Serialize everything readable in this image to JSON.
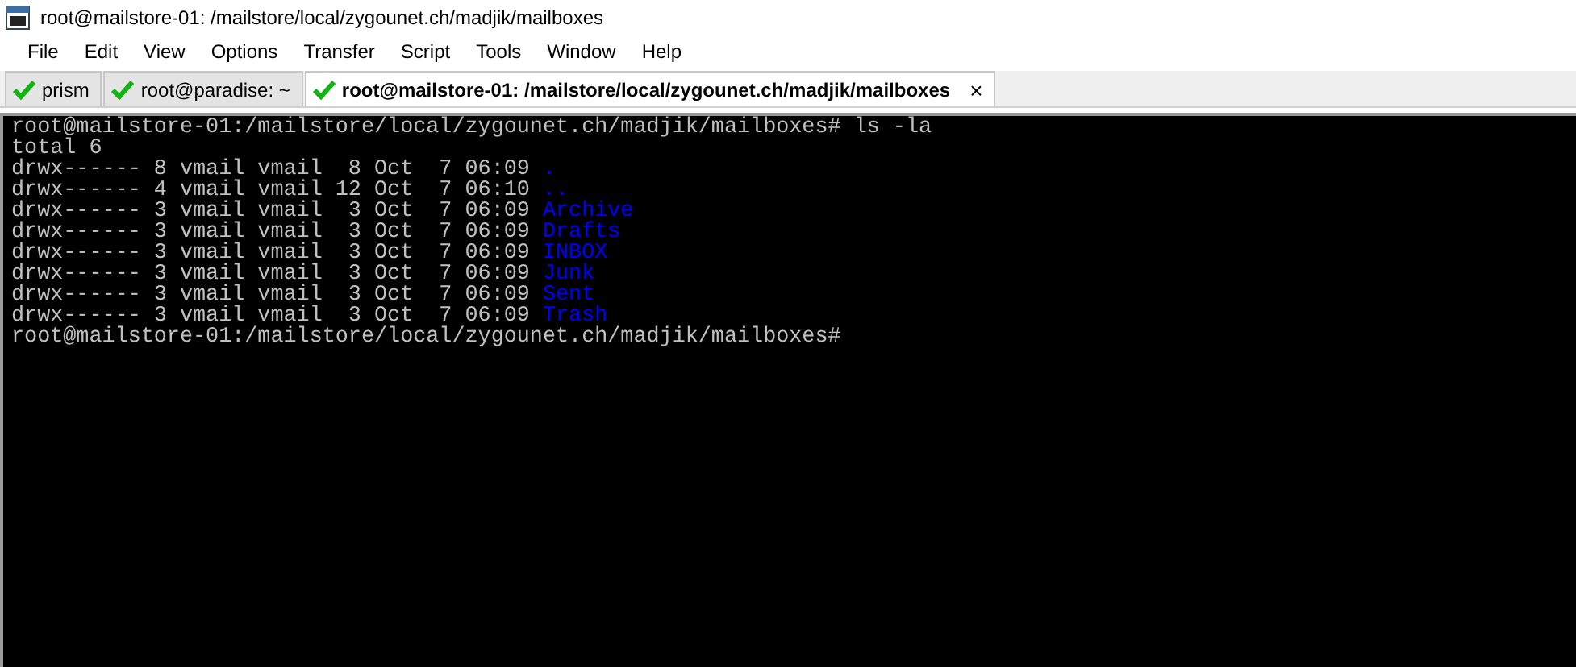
{
  "window": {
    "title": "root@mailstore-01: /mailstore/local/zygounet.ch/madjik/mailboxes"
  },
  "menu": [
    "File",
    "Edit",
    "View",
    "Options",
    "Transfer",
    "Script",
    "Tools",
    "Window",
    "Help"
  ],
  "tabs": [
    {
      "label": "prism",
      "connected": true,
      "selected": false
    },
    {
      "label": "root@paradise: ~",
      "connected": true,
      "selected": false
    },
    {
      "label": "root@mailstore-01: /mailstore/local/zygounet.ch/madjik/mailboxes",
      "connected": true,
      "selected": true,
      "close": "×"
    }
  ],
  "terminal": {
    "lines": [
      {
        "text": "root@mailstore-01:/mailstore/local/zygounet.ch/madjik/mailboxes# ls -la"
      },
      {
        "text": "total 6"
      },
      {
        "text": "drwx------ 8 vmail vmail  8 Oct  7 06:09 ",
        "dir": "."
      },
      {
        "text": "drwx------ 4 vmail vmail 12 Oct  7 06:10 ",
        "dir": ".."
      },
      {
        "text": "drwx------ 3 vmail vmail  3 Oct  7 06:09 ",
        "dir": "Archive"
      },
      {
        "text": "drwx------ 3 vmail vmail  3 Oct  7 06:09 ",
        "dir": "Drafts"
      },
      {
        "text": "drwx------ 3 vmail vmail  3 Oct  7 06:09 ",
        "dir": "INBOX"
      },
      {
        "text": "drwx------ 3 vmail vmail  3 Oct  7 06:09 ",
        "dir": "Junk"
      },
      {
        "text": "drwx------ 3 vmail vmail  3 Oct  7 06:09 ",
        "dir": "Sent"
      },
      {
        "text": "drwx------ 3 vmail vmail  3 Oct  7 06:09 ",
        "dir": "Trash"
      },
      {
        "text": "root@mailstore-01:/mailstore/local/zygounet.ch/madjik/mailboxes#"
      }
    ]
  }
}
